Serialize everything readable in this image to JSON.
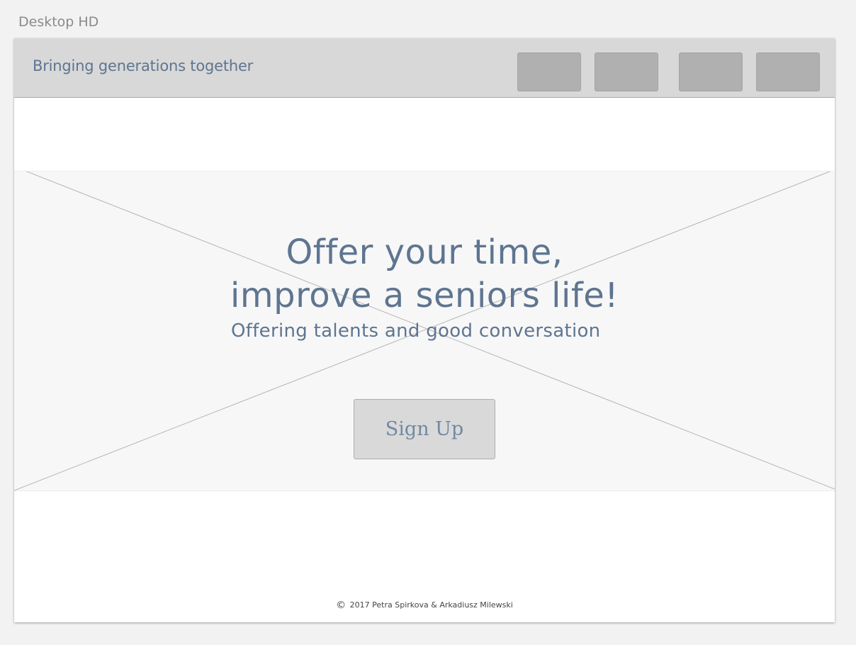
{
  "artboard": {
    "label": "Desktop HD"
  },
  "header": {
    "brand": "Bringing generations together",
    "nav_buttons": [
      "",
      "",
      "",
      ""
    ]
  },
  "hero": {
    "headline_line1": "Offer your time,",
    "headline_line2": "improve a seniors life!",
    "subheadline": "Offering talents and good conversation",
    "cta_label": "Sign Up",
    "placeholder_icon": "image-placeholder-x"
  },
  "footer": {
    "copyright_icon": "copyright-icon",
    "text": "2017 Petra Spirkova & Arkadiusz Milewski"
  },
  "colors": {
    "text_accent": "#5e7590",
    "cta_text": "#7189a4",
    "topbar_bg": "#d8d8d8",
    "nav_button_bg": "#b0b0b0",
    "hero_bg": "#f7f7f7"
  }
}
